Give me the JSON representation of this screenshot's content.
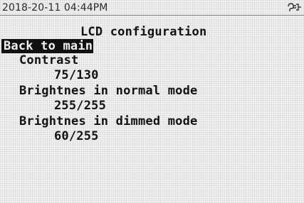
{
  "status": {
    "datetime": "2018-20-11 04:44PM",
    "icon": "network-connection-icon"
  },
  "screen": {
    "title": "LCD configuration",
    "selected_item": "Back to main",
    "items": [
      {
        "label": "Contrast",
        "value": "75/130"
      },
      {
        "label": "Brightnes in normal mode",
        "value": "255/255"
      },
      {
        "label": "Brightnes in dimmed mode",
        "value": "60/255"
      }
    ]
  },
  "colors": {
    "background": "#f1f1f1",
    "text": "#111111",
    "highlight_background": "#111111",
    "highlight_text": "#f2f2f2"
  }
}
